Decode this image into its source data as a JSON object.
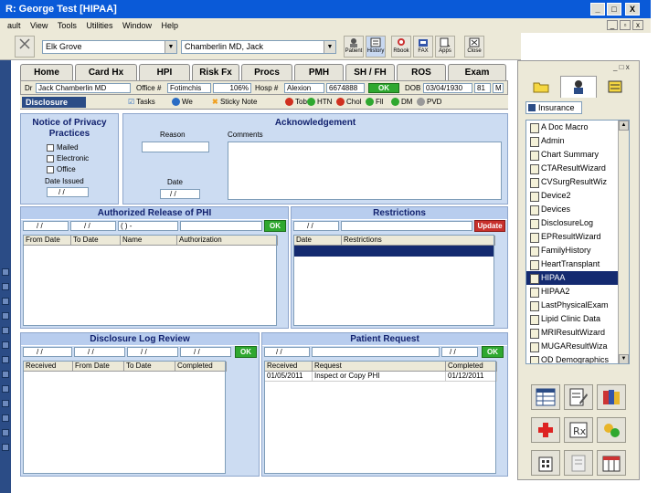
{
  "window": {
    "title": "R: George Test   [HIPAA]",
    "min": "_",
    "max": "□",
    "close": "X"
  },
  "menu": [
    "ault",
    "View",
    "Tools",
    "Utilities",
    "Window",
    "Help"
  ],
  "toolbar": {
    "location": "Elk Grove",
    "provider": "Chamberlin MD, Jack",
    "tools": [
      "Patient",
      "History",
      "Rbook",
      "FAX",
      "Apps",
      "Close"
    ]
  },
  "tabs": [
    "Home",
    "Card Hx",
    "HPI",
    "Risk Fx",
    "Procs",
    "PMH",
    "SH / FH",
    "ROS",
    "Exam"
  ],
  "patient": {
    "dr_label": "Dr",
    "dr": "Jack Chamberlin MD",
    "office_label": "Office #",
    "office": "Fotimchis",
    "office_val": "106%",
    "hosp_label": "Hosp #",
    "hosp": "Alexion",
    "hosp_val": "6674888",
    "ok": "OK",
    "dob_label": "DOB",
    "dob": "03/04/1930",
    "age": "81",
    "sex": "M"
  },
  "indicators": {
    "tab_label": "Disclosure",
    "items": [
      {
        "label": "Tasks",
        "color": "#ffffff"
      },
      {
        "label": "We",
        "color": "#2a6cc4"
      },
      {
        "label": "Sticky Note",
        "color": "#f0a020"
      },
      {
        "label": "Tob",
        "color": "#d03020"
      },
      {
        "label": "HTN",
        "color": "#2fa830"
      },
      {
        "label": "Chol",
        "color": "#d03020"
      },
      {
        "label": "Fll",
        "color": "#2fa830"
      },
      {
        "label": "DM",
        "color": "#2fa830"
      },
      {
        "label": "PVD",
        "color": "#999999"
      }
    ]
  },
  "notice": {
    "title": "Notice of Privacy Practices",
    "options": [
      "Mailed",
      "Electronic",
      "Office"
    ],
    "date_issued_label": "Date Issued",
    "date_issued": " /  / "
  },
  "ack": {
    "title": "Acknowledgement",
    "reason_label": "Reason",
    "comments_label": "Comments",
    "date_label": "Date",
    "date": " /  / "
  },
  "release": {
    "title": "Authorized Release of PHI",
    "inputs": [
      " /  / ",
      " /  / ",
      "(  )  -"
    ],
    "ok": "OK",
    "columns": [
      "From Date",
      "To Date",
      "Name",
      "Authorization"
    ]
  },
  "restrictions": {
    "title": "Restrictions",
    "date": " /  / ",
    "update": "Update",
    "columns": [
      "Date",
      "Restrictions"
    ]
  },
  "disclosure_log": {
    "title": "Disclosure Log Review",
    "inputs": [
      " /  / ",
      " /  / ",
      " /  / ",
      " /  / "
    ],
    "ok": "OK",
    "columns": [
      "Received",
      "From Date",
      "To Date",
      "Completed"
    ]
  },
  "patient_request": {
    "title": "Patient Request",
    "inputs": [
      " /  / ",
      " /  / "
    ],
    "ok": "OK",
    "columns": [
      "Received",
      "Request",
      "Completed"
    ],
    "rows": [
      [
        "01/05/2011",
        "Inspect or Copy PHI",
        "01/12/2011"
      ]
    ]
  },
  "right_panel": {
    "insurance": "Insurance",
    "items": [
      "A Doc Macro",
      "Admin",
      "Chart Summary",
      "CTAResultWizard",
      "CVSurgResultWiz",
      "Device2",
      "Devices",
      "DisclosureLog",
      "EPResultWizard",
      "FamilyHistory",
      "HeartTransplant",
      "HIPAA",
      "HIPAA2",
      "LastPhysicalExam",
      "Lipid Clinic Data",
      "MRIResultWizard",
      "MUGAResultWiza",
      "OD Demographics"
    ],
    "selected": "HIPAA"
  }
}
